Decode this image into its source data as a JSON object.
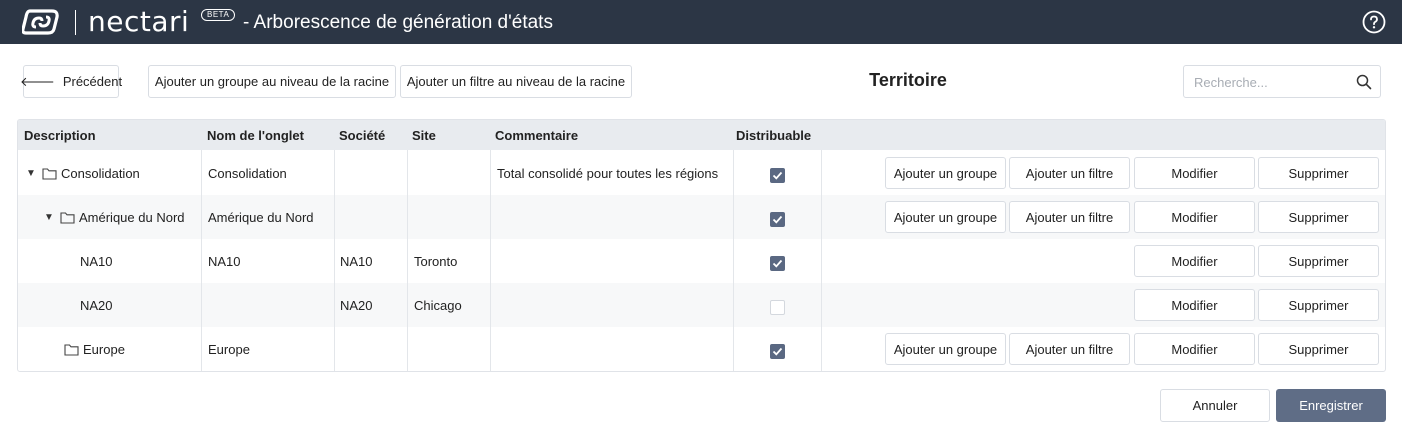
{
  "header": {
    "brand": "nectari",
    "beta": "BETA",
    "title": "- Arborescence de génération d'états"
  },
  "toolbar": {
    "back_label": "Précédent",
    "add_group_root": "Ajouter un groupe au niveau de la racine",
    "add_filter_root": "Ajouter un filtre au niveau de la racine",
    "page_title": "Territoire",
    "search_placeholder": "Recherche..."
  },
  "table": {
    "columns": [
      "Description",
      "Nom de l'onglet",
      "Société",
      "Site",
      "Commentaire",
      "Distribuable"
    ],
    "rows": [
      {
        "description": "Consolidation",
        "tab_name": "Consolidation",
        "company": "",
        "site": "",
        "comment": "Total consolidé pour toutes les régions",
        "distributable": true,
        "type": "group",
        "expanded": true
      },
      {
        "description": "Amérique du Nord",
        "tab_name": "Amérique du Nord",
        "company": "",
        "site": "",
        "comment": "",
        "distributable": true,
        "type": "group",
        "expanded": true
      },
      {
        "description": "NA10",
        "tab_name": "NA10",
        "company": "NA10",
        "site": "Toronto",
        "comment": "",
        "distributable": true,
        "type": "filter"
      },
      {
        "description": "NA20",
        "tab_name": "",
        "company": "NA20",
        "site": "Chicago",
        "comment": "",
        "distributable": false,
        "type": "filter"
      },
      {
        "description": "Europe",
        "tab_name": "Europe",
        "company": "",
        "site": "",
        "comment": "",
        "distributable": true,
        "type": "group",
        "expanded": false
      }
    ],
    "actions": {
      "add_group": "Ajouter un groupe",
      "add_filter": "Ajouter un filtre",
      "edit": "Modifier",
      "delete": "Supprimer"
    }
  },
  "footer": {
    "cancel": "Annuler",
    "save": "Enregistrer"
  },
  "colors": {
    "topbar": "#2c3645",
    "accent": "#5f6d86",
    "header_row": "#e8ebef"
  }
}
